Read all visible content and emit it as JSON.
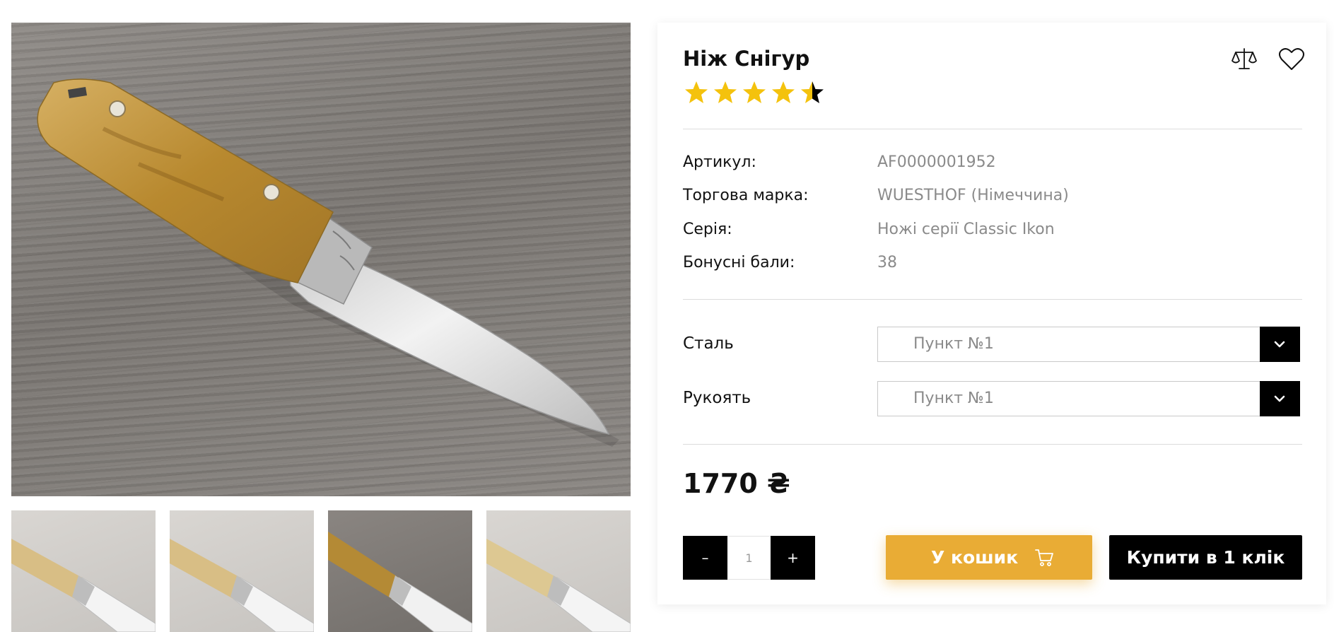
{
  "product": {
    "title": "Ніж Снігур",
    "rating": 4.5,
    "rating_max": 5,
    "star_color": "#f4c20d"
  },
  "specs": [
    {
      "label": "Артикул:",
      "value": "AF0000001952"
    },
    {
      "label": "Торгова марка:",
      "value": "WUESTHOF (Німеччина)"
    },
    {
      "label": "Серія:",
      "value": "Ножі серії Classic Ikon"
    },
    {
      "label": "Бонусні бали:",
      "value": "38"
    }
  ],
  "options": [
    {
      "label": "Сталь",
      "selected": "Пункт №1"
    },
    {
      "label": "Рукоять",
      "selected": "Пункт №1"
    }
  ],
  "price": "1770 ₴",
  "quantity": {
    "minus": "–",
    "value": "1",
    "plus": "+"
  },
  "actions": {
    "cart_label": "У кошик",
    "buy_one_click_label": "Купити в 1 клік"
  },
  "colors": {
    "accent": "#e9ac35",
    "black": "#000000",
    "muted_text": "#8a8a8a"
  },
  "icons": {
    "compare": "scales-icon",
    "favorite": "heart-icon",
    "cart": "cart-icon",
    "dropdown": "chevron-down-icon"
  }
}
